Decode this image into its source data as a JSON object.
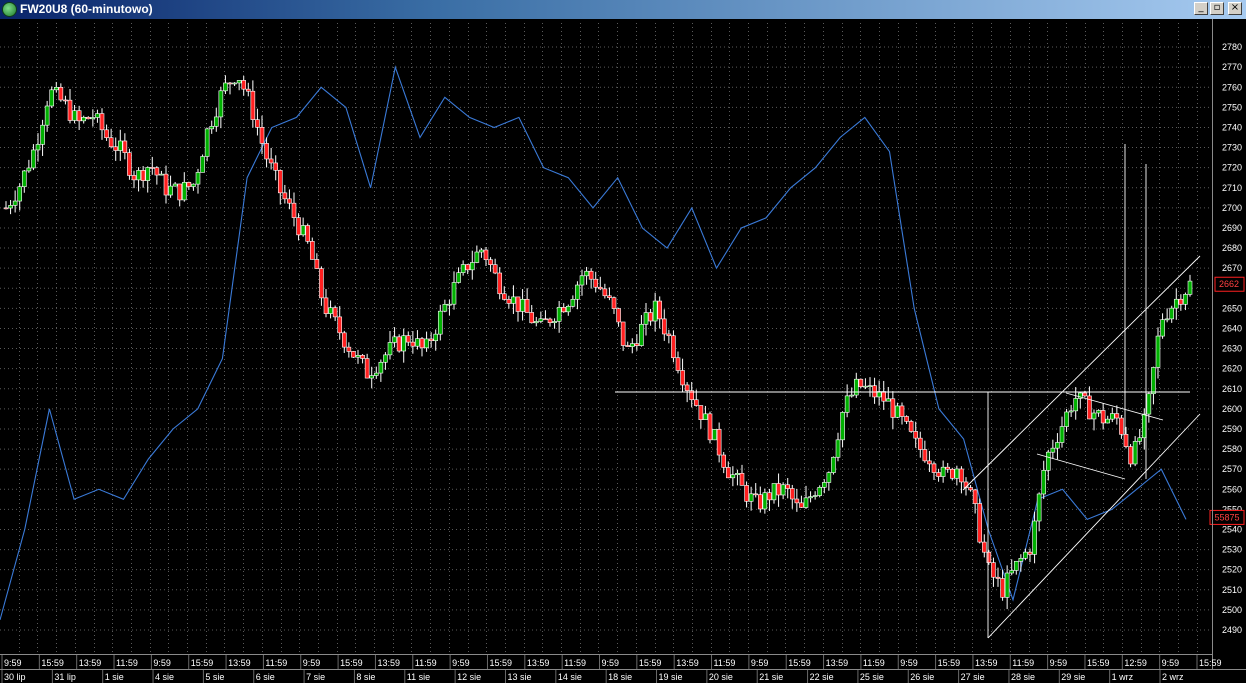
{
  "window": {
    "title": "FW20U8 (60-minutowo)",
    "buttons": [
      "_",
      "▫",
      "×"
    ]
  },
  "chart_data": {
    "type": "candlestick",
    "ylim": [
      2487,
      2785
    ],
    "y_ticks": [
      2490,
      2500,
      2510,
      2520,
      2530,
      2540,
      2550,
      2560,
      2570,
      2580,
      2590,
      2600,
      2610,
      2620,
      2630,
      2640,
      2650,
      2660,
      2670,
      2680,
      2690,
      2700,
      2710,
      2720,
      2730,
      2740,
      2750,
      2760,
      2770,
      2780
    ],
    "last_price_label": "2662",
    "last_price": 2662,
    "indicator_label": "55875",
    "indicator_level": 2546,
    "colors": {
      "up": "#00b000",
      "down": "#ff2020",
      "indicator": "#3a7ad8",
      "grid": "#5a5a5a",
      "background": "#000000"
    },
    "time_labels": [
      "9:59",
      "15:59",
      "13:59",
      "11:59",
      "9:59",
      "15:59",
      "13:59",
      "11:59",
      "9:59",
      "15:59",
      "13:59",
      "11:59",
      "9:59",
      "15:59",
      "13:59",
      "11:59",
      "9:59",
      "15:59",
      "13:59",
      "11:59",
      "9:59",
      "15:59",
      "13:59",
      "11:59",
      "9:59",
      "15:59",
      "13:59",
      "11:59",
      "9:59",
      "15:59",
      "12:59",
      "9:59",
      "15:59"
    ],
    "date_labels": [
      "30 lip",
      "31 lip",
      "1 sie",
      "4 sie",
      "5 sie",
      "6 sie",
      "7 sie",
      "8 sie",
      "11 sie",
      "12 sie",
      "13 sie",
      "14 sie",
      "18 sie",
      "19 sie",
      "20 sie",
      "21 sie",
      "22 sie",
      "25 sie",
      "26 sie",
      "27 sie",
      "28 sie",
      "29 sie",
      "1 wrz",
      "2 wrz"
    ],
    "close_path": [
      2700,
      2712,
      2730,
      2758,
      2752,
      2742,
      2746,
      2735,
      2728,
      2715,
      2722,
      2710,
      2708,
      2712,
      2740,
      2758,
      2768,
      2750,
      2726,
      2708,
      2695,
      2680,
      2652,
      2640,
      2628,
      2618,
      2625,
      2632,
      2636,
      2628,
      2645,
      2660,
      2672,
      2680,
      2664,
      2655,
      2648,
      2640,
      2648,
      2655,
      2668,
      2662,
      2650,
      2628,
      2640,
      2650,
      2634,
      2614,
      2600,
      2586,
      2570,
      2560,
      2552,
      2558,
      2560,
      2548,
      2560,
      2570,
      2600,
      2612,
      2608,
      2604,
      2594,
      2582,
      2576,
      2566,
      2572,
      2552,
      2520,
      2510,
      2522,
      2532,
      2575,
      2590,
      2606,
      2600,
      2595,
      2595,
      2575,
      2596,
      2645,
      2654,
      2662
    ],
    "indicator_path": [
      2495,
      2540,
      2600,
      2555,
      2560,
      2555,
      2575,
      2590,
      2600,
      2625,
      2715,
      2740,
      2745,
      2760,
      2750,
      2710,
      2770,
      2735,
      2755,
      2745,
      2740,
      2745,
      2720,
      2715,
      2700,
      2715,
      2690,
      2680,
      2700,
      2670,
      2690,
      2695,
      2710,
      2720,
      2735,
      2745,
      2728,
      2650,
      2600,
      2585,
      2540,
      2505,
      2555,
      2560,
      2545,
      2550,
      2560,
      2570,
      2545
    ]
  }
}
